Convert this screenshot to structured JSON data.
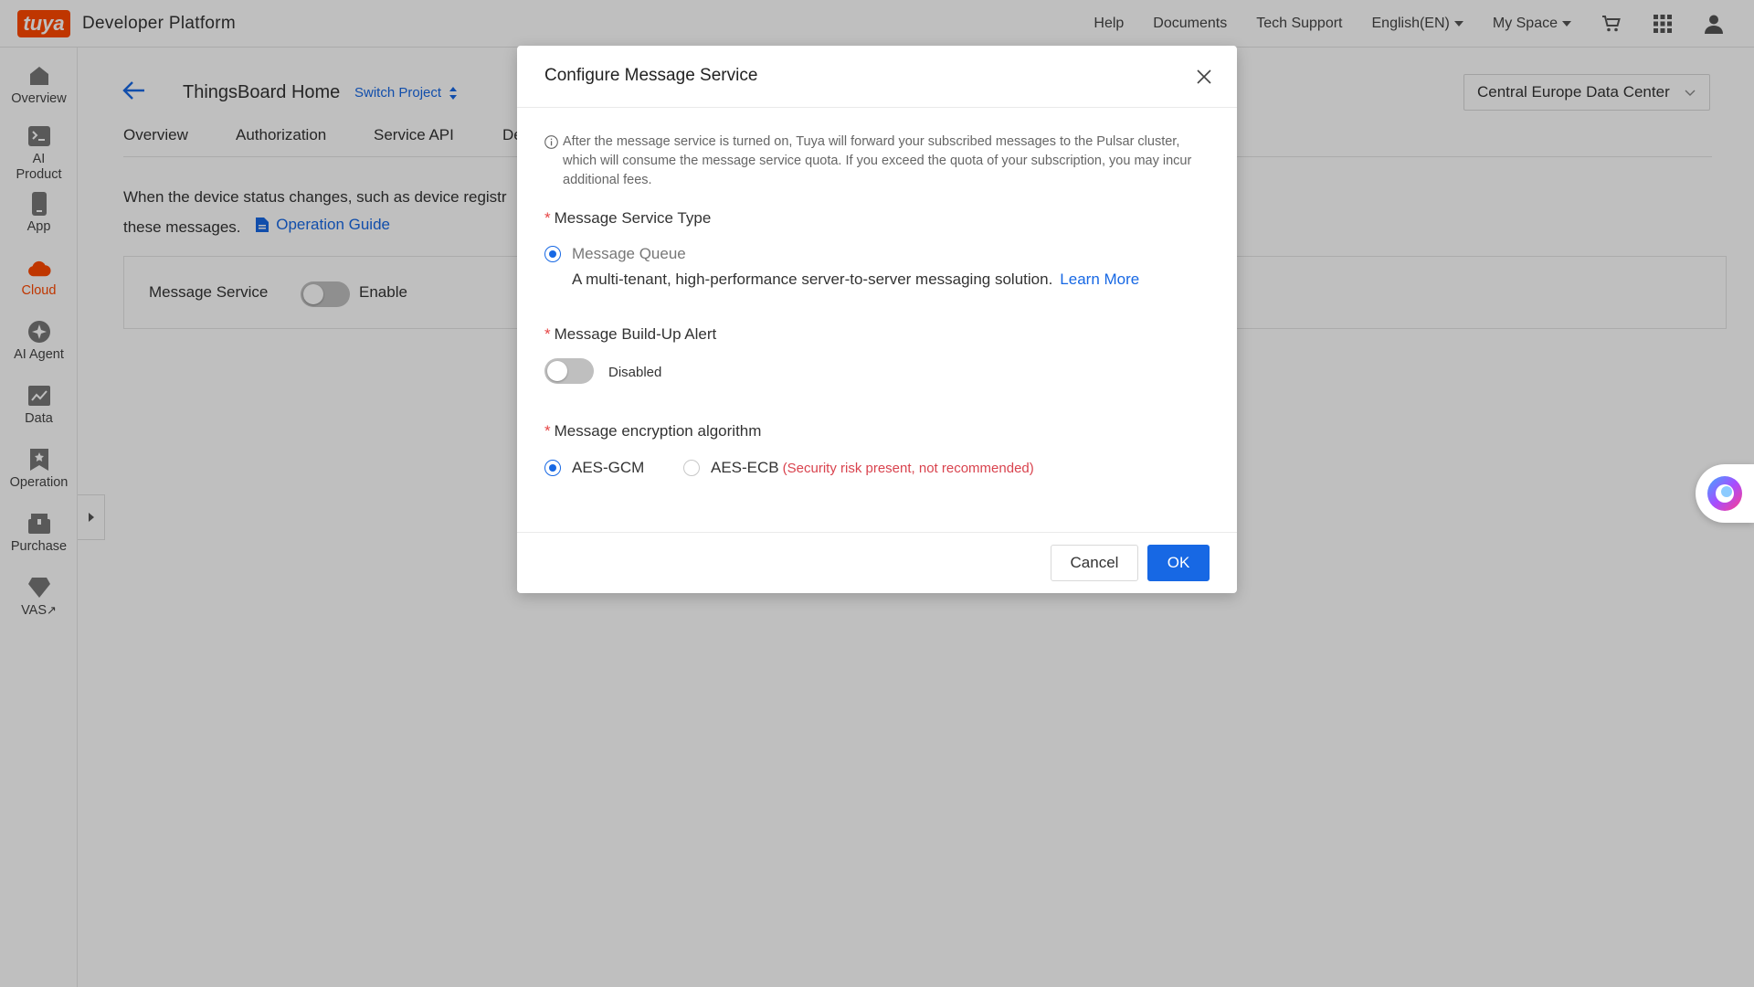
{
  "topbar": {
    "logo_text": "tuya",
    "title": "Developer Platform",
    "nav": {
      "help": "Help",
      "documents": "Documents",
      "tech_support": "Tech Support",
      "language": "English(EN)",
      "my_space": "My Space"
    },
    "icons": [
      "cart-icon",
      "apps-grid-icon",
      "user-icon"
    ]
  },
  "sidebar": {
    "items": [
      {
        "label": "Overview",
        "icon": "home-icon"
      },
      {
        "label": "AI Product",
        "icon": "terminal-icon"
      },
      {
        "label": "App",
        "icon": "phone-icon"
      },
      {
        "label": "Cloud",
        "icon": "cloud-icon",
        "active": true
      },
      {
        "label": "AI Agent",
        "icon": "sparkle-icon"
      },
      {
        "label": "Data",
        "icon": "chart-icon"
      },
      {
        "label": "Operation",
        "icon": "bookmark-icon"
      },
      {
        "label": "Purchase",
        "icon": "box-icon"
      },
      {
        "label": "VAS",
        "icon": "diamond-icon"
      }
    ],
    "vas_suffix": "↗"
  },
  "main": {
    "project_name": "ThingsBoard Home",
    "switch_project": "Switch Project",
    "data_center": "Central Europe Data Center",
    "tabs": [
      "Overview",
      "Authorization",
      "Service API",
      "De"
    ],
    "description_line1": "When the device status changes, such as device registr",
    "description_line2": "these messages.",
    "operation_guide": "Operation Guide",
    "service_label": "Message Service",
    "service_toggle_label": "Enable"
  },
  "modal": {
    "title": "Configure Message Service",
    "notice": "After the message service is turned on, Tuya will forward your subscribed messages to the Pulsar cluster, which will consume the message service quota. If you exceed the quota of your subscription, you may incur additional fees.",
    "required_mark": "*",
    "service_type_label": "Message Service Type",
    "service_type_option": "Message Queue",
    "service_type_desc": "A multi-tenant, high-performance server-to-server messaging solution.",
    "learn_more": "Learn More",
    "buildup_label": "Message Build-Up Alert",
    "buildup_state": "Disabled",
    "encryption_label": "Message encryption algorithm",
    "encryption_options": [
      {
        "label": "AES-GCM",
        "checked": true
      },
      {
        "label": "AES-ECB",
        "checked": false,
        "warning": "(Security risk present, not recommended)"
      }
    ],
    "cancel": "Cancel",
    "ok": "OK"
  },
  "colors": {
    "brand": "#ff4800",
    "primary": "#1768e4",
    "danger": "#d9434e"
  }
}
